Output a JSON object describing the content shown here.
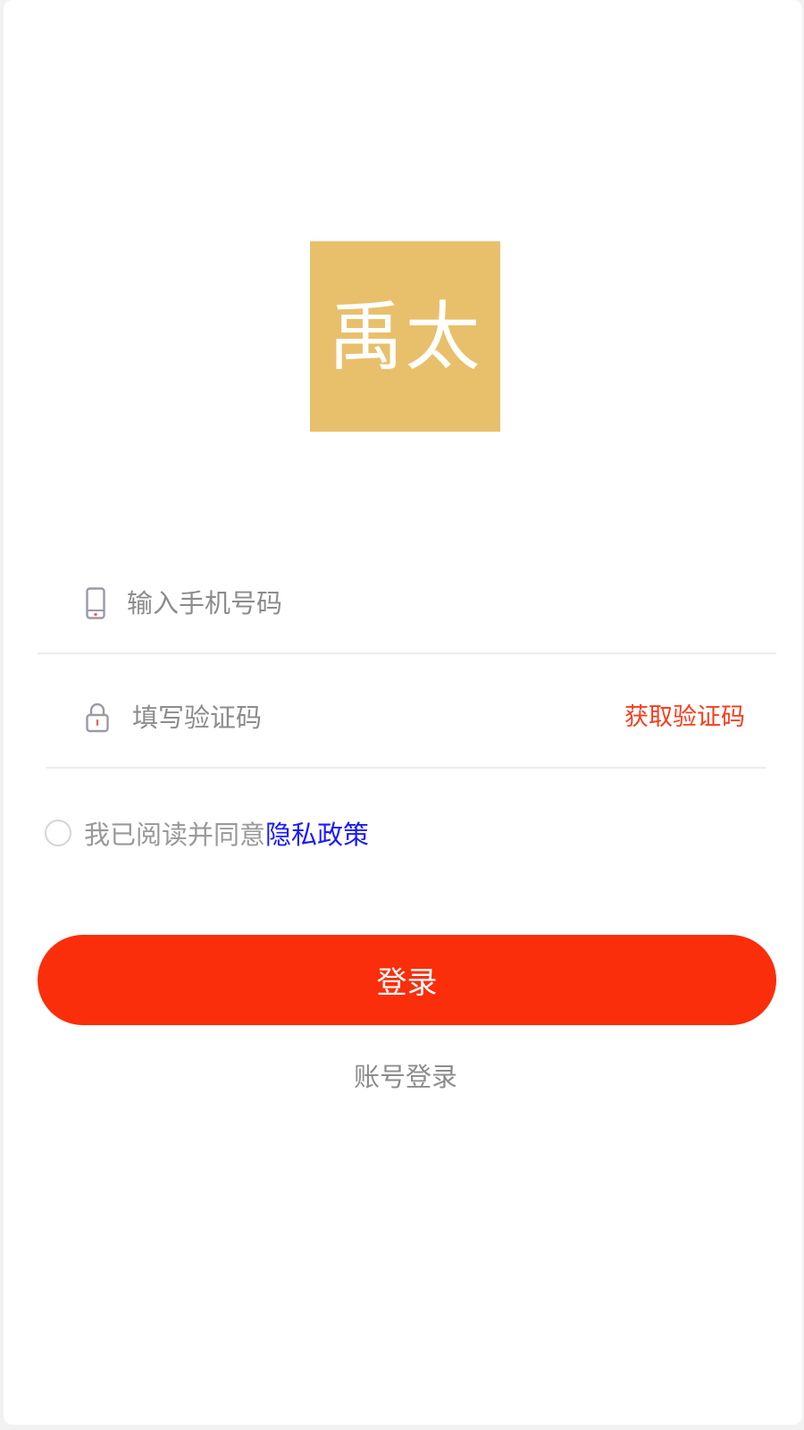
{
  "logo": {
    "text": "禹太",
    "background_color": "#e8c06b"
  },
  "phone_field": {
    "icon": "phone-icon",
    "placeholder": "输入手机号码",
    "value": ""
  },
  "code_field": {
    "icon": "lock-icon",
    "placeholder": "填写验证码",
    "value": "",
    "get_code_label": "获取验证码"
  },
  "agreement": {
    "checked": false,
    "text": "我已阅读并同意",
    "link_text": "隐私政策"
  },
  "login_button": {
    "label": "登录"
  },
  "account_login": {
    "label": "账号登录"
  },
  "colors": {
    "accent": "#fa2e0a",
    "link": "#1a1aff",
    "logo_gold": "#e8c06b"
  }
}
